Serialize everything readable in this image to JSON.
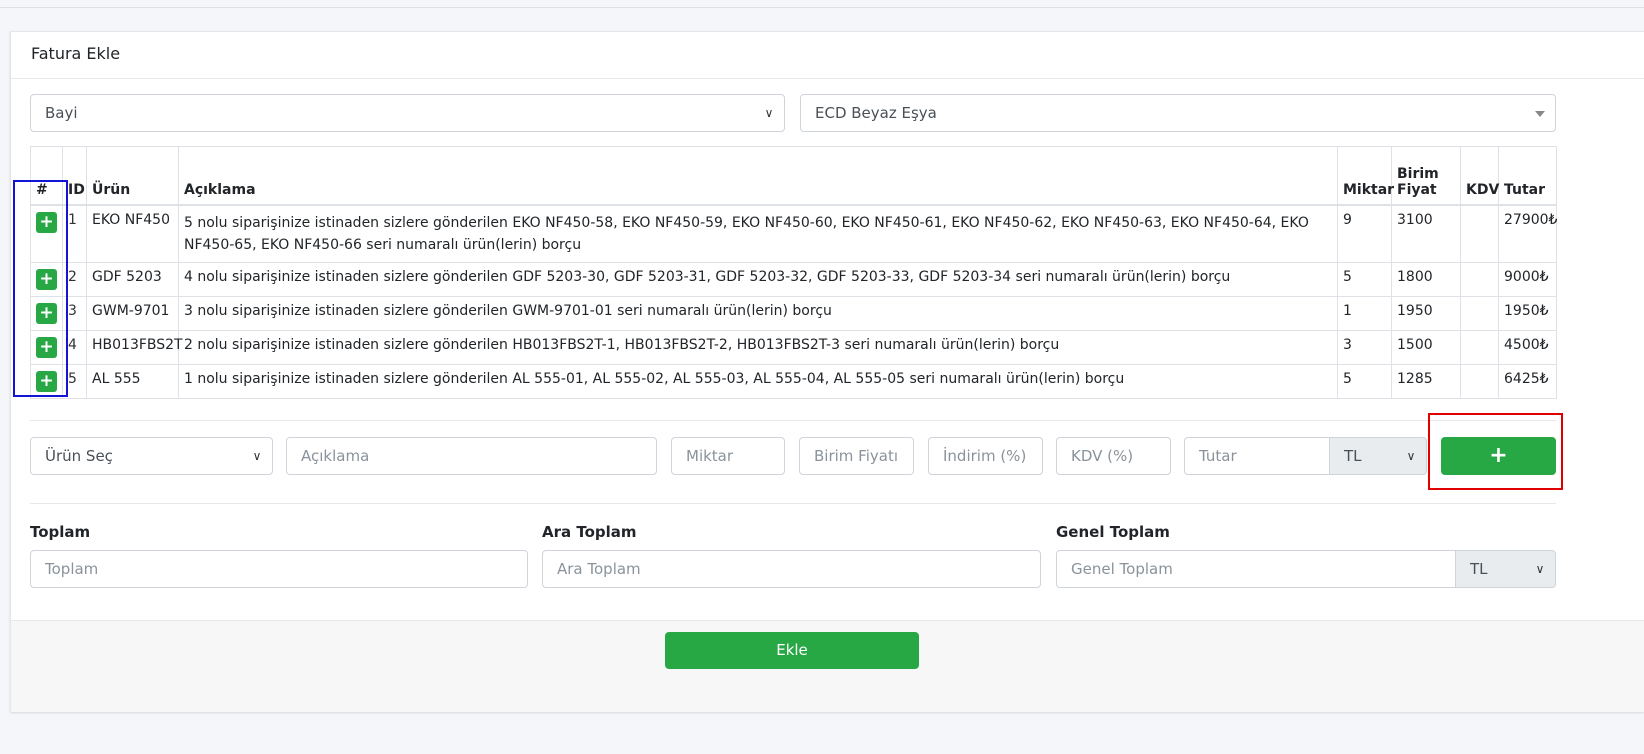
{
  "card": {
    "title": "Fatura Ekle"
  },
  "selectors": {
    "dealer_type": "Bayi",
    "dealer_name": "ECD Beyaz Eşya"
  },
  "table": {
    "headers": {
      "hash": "#",
      "id": "ID",
      "product": "Ürün",
      "description": "Açıklama",
      "quantity": "Miktar",
      "unit_price": "Birim Fiyat",
      "vat": "KDV",
      "amount": "Tutar"
    },
    "add_icon": "+",
    "rows": [
      {
        "id": "1",
        "product": "EKO NF450",
        "description": "5 nolu siparişinize istinaden sizlere gönderilen EKO NF450-58, EKO NF450-59, EKO NF450-60, EKO NF450-61, EKO NF450-62, EKO NF450-63, EKO NF450-64, EKO NF450-65, EKO NF450-66 seri numaralı ürün(lerin) borçu",
        "quantity": "9",
        "unit_price": "3100",
        "vat": "",
        "amount": "27900₺"
      },
      {
        "id": "2",
        "product": "GDF 5203",
        "description": "4 nolu siparişinize istinaden sizlere gönderilen GDF 5203-30, GDF 5203-31, GDF 5203-32, GDF 5203-33, GDF 5203-34 seri numaralı ürün(lerin) borçu",
        "quantity": "5",
        "unit_price": "1800",
        "vat": "",
        "amount": "9000₺"
      },
      {
        "id": "3",
        "product": "GWM-9701",
        "description": "3 nolu siparişinize istinaden sizlere gönderilen GWM-9701-01 seri numaralı ürün(lerin) borçu",
        "quantity": "1",
        "unit_price": "1950",
        "vat": "",
        "amount": "1950₺"
      },
      {
        "id": "4",
        "product": "HB013FBS2T",
        "description": "2 nolu siparişinize istinaden sizlere gönderilen HB013FBS2T-1, HB013FBS2T-2, HB013FBS2T-3 seri numaralı ürün(lerin) borçu",
        "quantity": "3",
        "unit_price": "1500",
        "vat": "",
        "amount": "4500₺"
      },
      {
        "id": "5",
        "product": "AL 555",
        "description": "1 nolu siparişinize istinaden sizlere gönderilen AL 555-01, AL 555-02, AL 555-03, AL 555-04, AL 555-05 seri numaralı ürün(lerin) borçu",
        "quantity": "5",
        "unit_price": "1285",
        "vat": "",
        "amount": "6425₺"
      }
    ]
  },
  "entry": {
    "product_select": "Ürün Seç",
    "description_placeholder": "Açıklama",
    "quantity_placeholder": "Miktar",
    "unit_price_placeholder": "Birim Fiyatı",
    "discount_placeholder": "İndirim (%)",
    "vat_placeholder": "KDV (%)",
    "amount_placeholder": "Tutar",
    "currency": "TL",
    "add_button": "+"
  },
  "totals": {
    "total_label": "Toplam",
    "total_placeholder": "Toplam",
    "subtotal_label": "Ara Toplam",
    "subtotal_placeholder": "Ara Toplam",
    "grand_label": "Genel Toplam",
    "grand_placeholder": "Genel Toplam",
    "currency": "TL"
  },
  "footer": {
    "submit_button": "Ekle"
  },
  "colors": {
    "green": "#28a745",
    "blue_highlight": "#1414d6",
    "red_highlight": "#e00000"
  }
}
